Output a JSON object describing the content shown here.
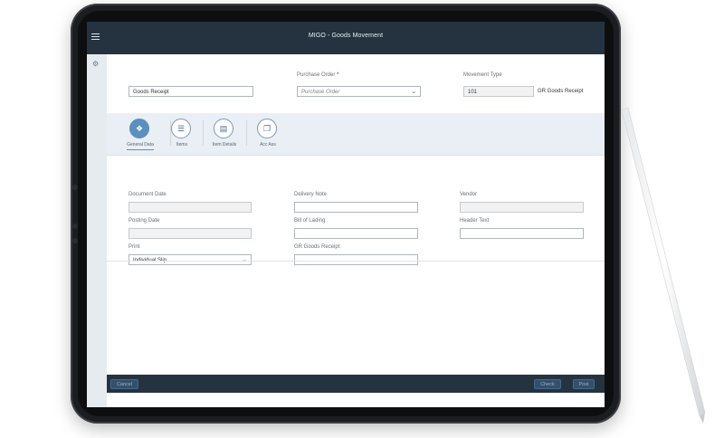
{
  "app": {
    "title": "MIGO - Goods Movement"
  },
  "header": {
    "action": {
      "value": "Goods Receipt"
    },
    "reference": {
      "label": "Purchase Order",
      "required_mark": "*",
      "placeholder": "Purchase Order"
    },
    "movement_type": {
      "label": "Movement Type",
      "value": "101",
      "text": "GR Goods Receipt"
    }
  },
  "tabs": [
    {
      "label": "General Data",
      "icon": "cube-icon",
      "active": true
    },
    {
      "label": "Items",
      "icon": "list-icon",
      "active": false
    },
    {
      "label": "Item Details",
      "icon": "clipboard-icon",
      "active": false
    },
    {
      "label": "Acc Ass",
      "icon": "documents-icon",
      "active": false
    }
  ],
  "general": {
    "document_date": {
      "label": "Document Date",
      "value": ""
    },
    "posting_date": {
      "label": "Posting Date",
      "value": ""
    },
    "print": {
      "label": "Print",
      "value": "Individual Slip"
    },
    "delivery_note": {
      "label": "Delivery Note",
      "value": ""
    },
    "bill_of_lading": {
      "label": "Bill of Lading",
      "value": ""
    },
    "gr_goods_receipt": {
      "label": "GR Goods Receipt",
      "value": ""
    },
    "vendor": {
      "label": "Vendor",
      "value": ""
    },
    "header_text": {
      "label": "Header Text",
      "value": ""
    }
  },
  "footer": {
    "cancel": "Cancel",
    "check": "Check",
    "post": "Post"
  },
  "colors": {
    "shell": "#253340",
    "accent": "#5a8fbf",
    "required": "#bb0000"
  }
}
